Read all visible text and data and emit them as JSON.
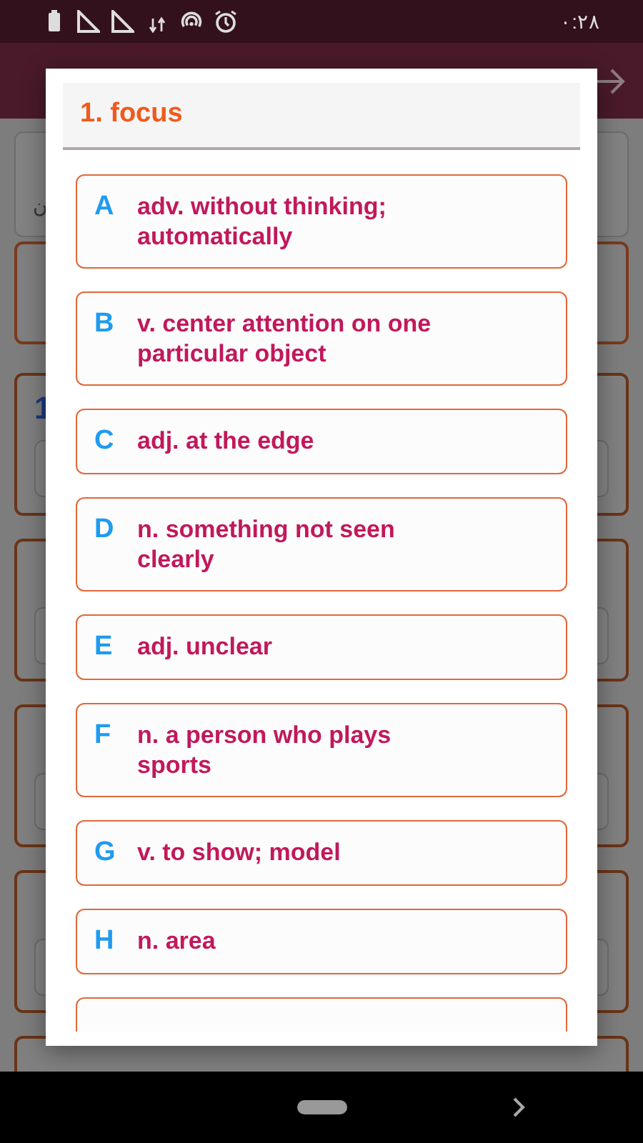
{
  "status_bar": {
    "time": "۰:۲۸"
  },
  "background": {
    "hint": "ن",
    "cards": [
      {
        "label": "1"
      }
    ]
  },
  "dialog": {
    "title": "1. focus",
    "more_below": true,
    "options": [
      {
        "letter": "A",
        "text": "adv. without thinking; automatically"
      },
      {
        "letter": "B",
        "text": "v. center attention on one particular object"
      },
      {
        "letter": "C",
        "text": "adj. at the edge"
      },
      {
        "letter": "D",
        "text": "n. something not seen clearly"
      },
      {
        "letter": "E",
        "text": "adj. unclear"
      },
      {
        "letter": "F",
        "text": "n. a person who plays sports"
      },
      {
        "letter": "G",
        "text": "v. to show; model"
      },
      {
        "letter": "H",
        "text": "n. area"
      }
    ]
  }
}
